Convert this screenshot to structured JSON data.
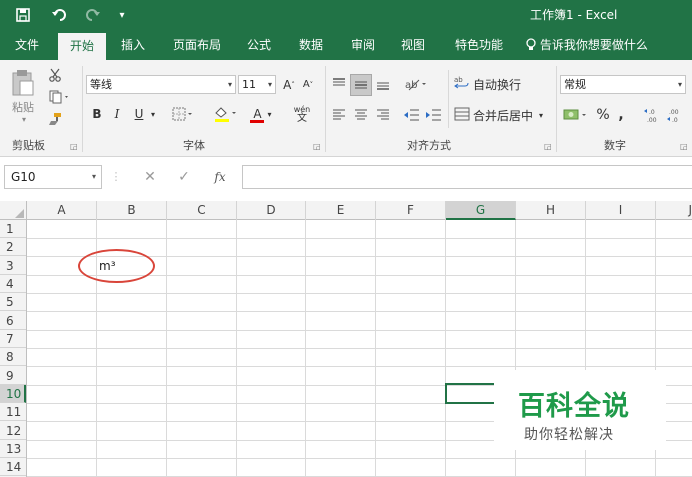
{
  "window": {
    "title": "工作簿1 - Excel"
  },
  "qat": {
    "save": "save-icon",
    "undo": "undo-icon",
    "redo": "redo-icon",
    "customize": "customize-icon"
  },
  "tabs": [
    {
      "label": "文件"
    },
    {
      "label": "开始"
    },
    {
      "label": "插入"
    },
    {
      "label": "页面布局"
    },
    {
      "label": "公式"
    },
    {
      "label": "数据"
    },
    {
      "label": "审阅"
    },
    {
      "label": "视图"
    },
    {
      "label": "特色功能"
    }
  ],
  "active_tab": "开始",
  "tell_me": "告诉我你想要做什么",
  "ribbon": {
    "clipboard": {
      "paste_label": "粘贴",
      "group_label": "剪贴板"
    },
    "font": {
      "font_name": "等线",
      "font_size": "11",
      "bold": "B",
      "italic": "I",
      "underline": "U",
      "group_label": "字体",
      "grow": "A",
      "shrink": "A",
      "phonetic_top": "wén",
      "phonetic_bottom": "文",
      "font_color": "A"
    },
    "alignment": {
      "wrap_text": "自动换行",
      "merge_center": "合并后居中",
      "group_label": "对齐方式"
    },
    "number": {
      "format": "常规",
      "percent": "%",
      "comma": ",",
      "dec_inc": "←.0 .00",
      "dec_dec": ".00 →.0",
      "group_label": "数字"
    }
  },
  "formula_bar": {
    "name_box": "G10",
    "fx_label": "fx",
    "formula": ""
  },
  "grid": {
    "columns": [
      "A",
      "B",
      "C",
      "D",
      "E",
      "F",
      "G",
      "H",
      "I",
      "J"
    ],
    "rows": [
      "1",
      "2",
      "3",
      "4",
      "5",
      "6",
      "7",
      "8",
      "9",
      "10",
      "11",
      "12",
      "13",
      "14"
    ],
    "selected_cell": "G10",
    "cells": {
      "B3": "m³"
    }
  },
  "watermark": {
    "title": "百科全说",
    "subtitle": "助你轻松解决"
  },
  "colors": {
    "excel_green": "#217346",
    "annotation_red": "#d9453a",
    "watermark_green": "#1f9a4a"
  }
}
